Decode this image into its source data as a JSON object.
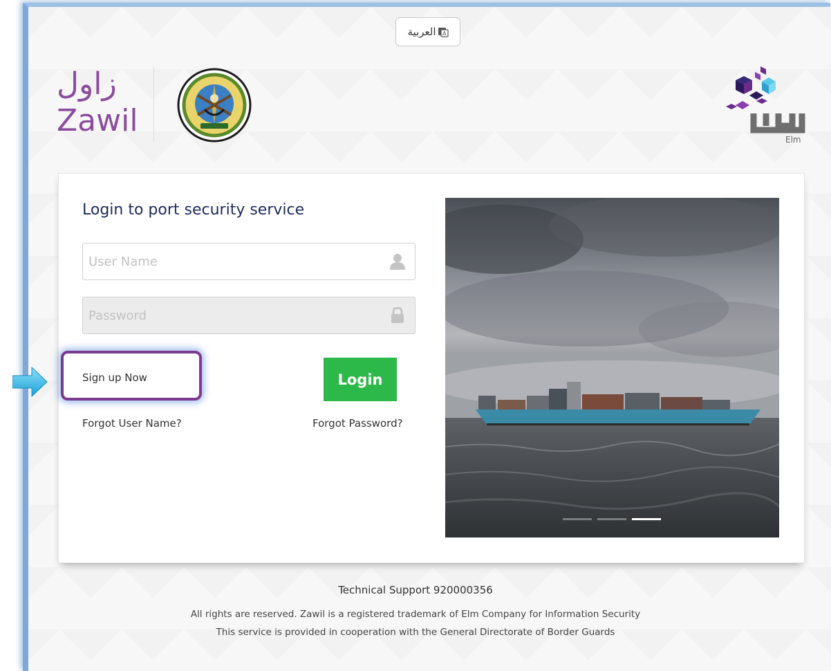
{
  "language_toggle": {
    "label": "العربية"
  },
  "branding": {
    "app_name_ar": "زاول",
    "app_name_en": "Zawil",
    "partner_name": "Elm",
    "partner_name_ar": "علم"
  },
  "login": {
    "title": "Login to port security service",
    "username_placeholder": "User Name",
    "password_placeholder": "Password",
    "signup_label": "Sign up Now",
    "login_label": "Login",
    "forgot_username_label": "Forgot User Name?",
    "forgot_password_label": "Forgot Password?"
  },
  "carousel": {
    "slide_count": 3,
    "active_index": 2
  },
  "footer": {
    "support": "Technical Support 920000356",
    "rights": "All rights are reserved. Zawil is a registered trademark of Elm Company for Information Security",
    "cooperation": "This service is provided in cooperation with the General Directorate of Border Guards"
  },
  "colors": {
    "brand_purple": "#8b4c9e",
    "login_green": "#2db84a",
    "highlight_border": "#7b3a90",
    "title_navy": "#1d2a5a",
    "arrow_blue": "#3fb7e8"
  }
}
